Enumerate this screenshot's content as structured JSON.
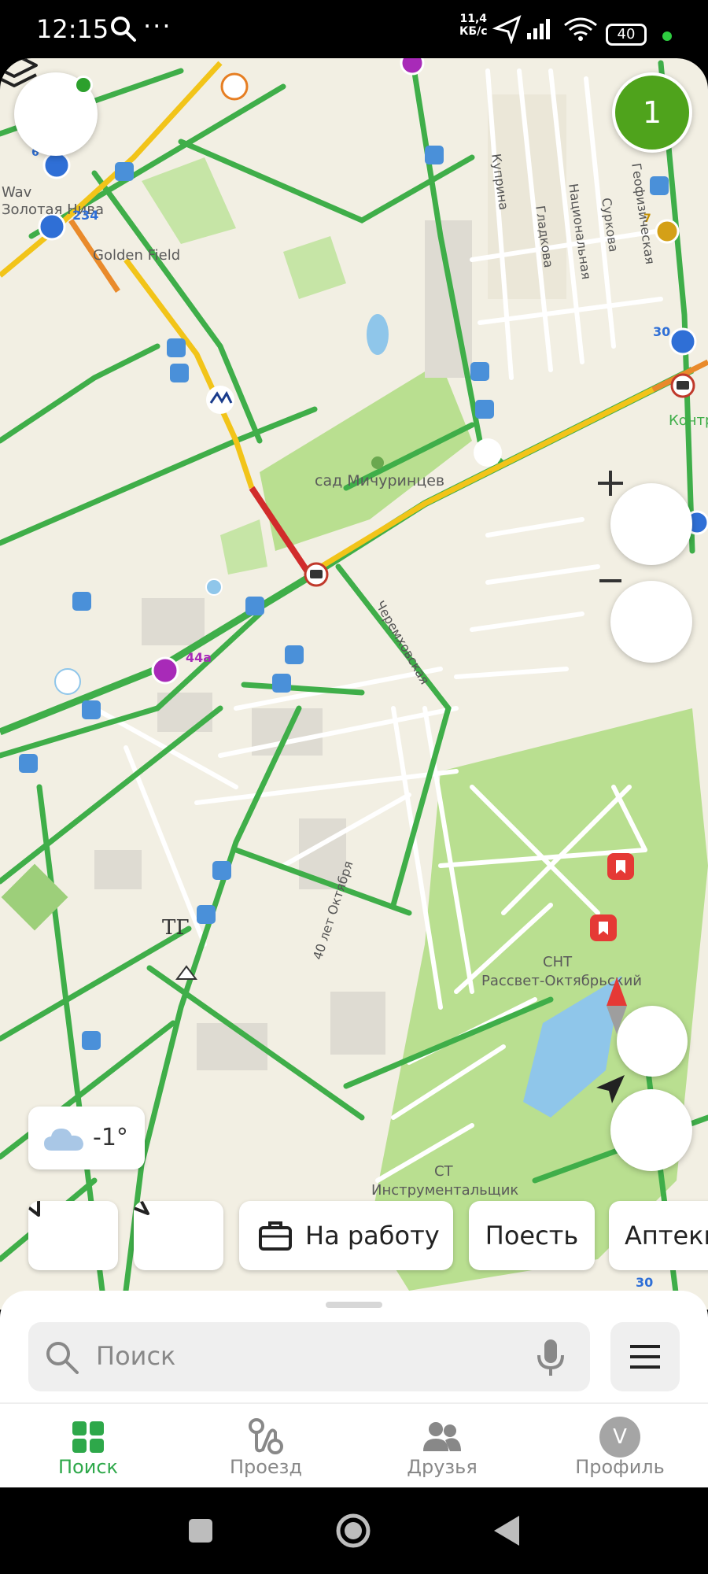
{
  "status_bar": {
    "time": "12:15",
    "more": "···",
    "network_speed_value": "11,4",
    "network_speed_unit": "КБ/с",
    "battery": "40"
  },
  "map": {
    "route_badge": "1",
    "labels": {
      "zolotaya_niva": "Золотая Нива",
      "golden_field": "Golden Field",
      "sad_michurintsev": "сад Мичуринцев",
      "snt": "СНТ",
      "snt_name": "Рассвет-Октябрьский",
      "st": "СТ",
      "st_name": "Инструментальщик",
      "tg": "ТГ",
      "waw": "Wav",
      "kontr": "Контр",
      "route_234": "234",
      "route_44a": "44а",
      "route_30": "30",
      "route_30b": "30",
      "route_6": "6",
      "route_7": "7"
    },
    "streets": {
      "kuprina": "Куприна",
      "gladkova": "Гладкова",
      "natsionalnaya": "Национальная",
      "surkova": "Суркова",
      "geofizicheskaya": "Геофизическая",
      "cheremkhovskaya": "Черемховская",
      "let_oktyabrya": "40 лет Октября"
    },
    "weather": {
      "temp": "-1°"
    },
    "colors": {
      "traffic_green": "#3fae49",
      "traffic_yellow": "#f2c419",
      "traffic_red": "#d12b2b",
      "park": "#b9df90",
      "water": "#8fc6ea"
    }
  },
  "chips": [
    {
      "label": "На работу"
    },
    {
      "label": "Поесть"
    },
    {
      "label": "Аптеки"
    }
  ],
  "search": {
    "placeholder": "Поиск"
  },
  "bottom_nav": [
    {
      "label": "Поиск",
      "active": true,
      "icon": "grid-icon"
    },
    {
      "label": "Проезд",
      "active": false,
      "icon": "route-icon"
    },
    {
      "label": "Друзья",
      "active": false,
      "icon": "friends-icon"
    },
    {
      "label": "Профиль",
      "active": false,
      "icon": "avatar",
      "avatar_letter": "V"
    }
  ]
}
